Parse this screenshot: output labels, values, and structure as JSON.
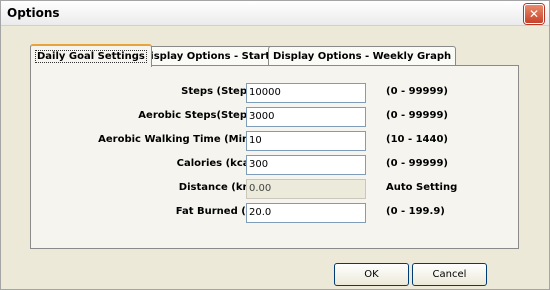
{
  "window": {
    "title": "Options"
  },
  "tabs": [
    {
      "label": "Daily Goal Settings",
      "active": true
    },
    {
      "label": "Display Options - Startup",
      "active": false
    },
    {
      "label": "Display Options - Weekly Graph",
      "active": false
    }
  ],
  "fields": [
    {
      "label": "Steps (Steps) :",
      "value": "10000",
      "range": "(0 - 99999)",
      "enabled": true
    },
    {
      "label": "Aerobic Steps(Steps) :",
      "value": "3000",
      "range": "(0 - 99999)",
      "enabled": true
    },
    {
      "label": "Aerobic Walking Time (Min.) :",
      "value": "10",
      "range": "(10 - 1440)",
      "enabled": true
    },
    {
      "label": "Calories (kcal) :",
      "value": "300",
      "range": "(0 - 99999)",
      "enabled": true
    },
    {
      "label": "Distance (km) :",
      "value": "0.00",
      "range": "Auto Setting",
      "enabled": false
    },
    {
      "label": "Fat Burned (g) :",
      "value": "20.0",
      "range": "(0 - 199.9)",
      "enabled": true
    }
  ],
  "buttons": {
    "ok": "OK",
    "cancel": "Cancel"
  },
  "icons": {
    "close": "close-icon"
  },
  "colors": {
    "window_bg": "#ece9d8",
    "panel_bg": "#f5f4ee",
    "close_red": "#c8412a",
    "active_tab_accent": "#e8a33b"
  }
}
